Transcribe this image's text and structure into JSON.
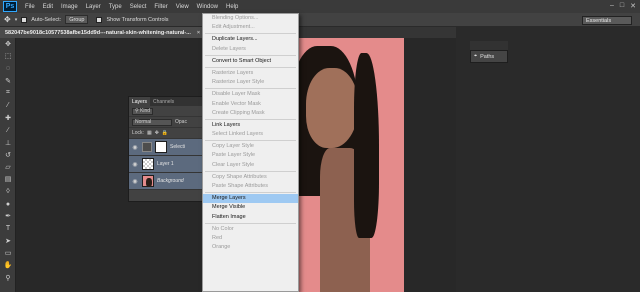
{
  "app": {
    "logo": "Ps"
  },
  "menubar": {
    "items": [
      "File",
      "Edit",
      "Image",
      "Layer",
      "Type",
      "Select",
      "Filter",
      "View",
      "Window",
      "Help"
    ]
  },
  "options_bar": {
    "auto_select_label": "Auto-Select:",
    "auto_select_value": "Group",
    "transform_controls_label": "Show Transform Controls",
    "workspace": "Essentials"
  },
  "document": {
    "tab_title": "582047be9018c10577538afbe15dd9d---natural-skin-whitening-natural-..."
  },
  "panels": {
    "paths_label": "Paths"
  },
  "layers_panel": {
    "tabs": [
      "Layers",
      "Channels"
    ],
    "kind_label": "Kind",
    "blend_mode": "Normal",
    "opacity_label": "Opac",
    "lock_label": "Lock:",
    "layers": [
      {
        "name": "Selecti",
        "selected": true
      },
      {
        "name": "Layer 1",
        "selected": true
      },
      {
        "name": "Background",
        "selected": true
      }
    ]
  },
  "context_menu": {
    "items": [
      {
        "label": "Blending Options...",
        "enabled": false
      },
      {
        "label": "Edit Adjustment...",
        "enabled": false
      },
      {
        "sep": true
      },
      {
        "label": "Duplicate Layers...",
        "enabled": true
      },
      {
        "label": "Delete Layers",
        "enabled": false
      },
      {
        "sep": true
      },
      {
        "label": "Convert to Smart Object",
        "enabled": true
      },
      {
        "sep": true
      },
      {
        "label": "Rasterize Layers",
        "enabled": false
      },
      {
        "label": "Rasterize Layer Style",
        "enabled": false
      },
      {
        "sep": true
      },
      {
        "label": "Disable Layer Mask",
        "enabled": false
      },
      {
        "label": "Enable Vector Mask",
        "enabled": false
      },
      {
        "label": "Create Clipping Mask",
        "enabled": false
      },
      {
        "sep": true
      },
      {
        "label": "Link Layers",
        "enabled": true
      },
      {
        "label": "Select Linked Layers",
        "enabled": false
      },
      {
        "sep": true
      },
      {
        "label": "Copy Layer Style",
        "enabled": false
      },
      {
        "label": "Paste Layer Style",
        "enabled": false
      },
      {
        "label": "Clear Layer Style",
        "enabled": false
      },
      {
        "sep": true
      },
      {
        "label": "Copy Shape Attributes",
        "enabled": false
      },
      {
        "label": "Paste Shape Attributes",
        "enabled": false
      },
      {
        "sep": true
      },
      {
        "label": "Merge Layers",
        "enabled": true,
        "highlighted": true
      },
      {
        "label": "Merge Visible",
        "enabled": true
      },
      {
        "label": "Flatten Image",
        "enabled": true
      },
      {
        "sep": true
      },
      {
        "label": "No Color",
        "enabled": false
      },
      {
        "label": "Red",
        "enabled": false
      },
      {
        "label": "Orange",
        "enabled": false
      }
    ]
  },
  "colors": {
    "accent_highlight": "#9ec9f2",
    "canvas_pink": "#e48b8b"
  }
}
